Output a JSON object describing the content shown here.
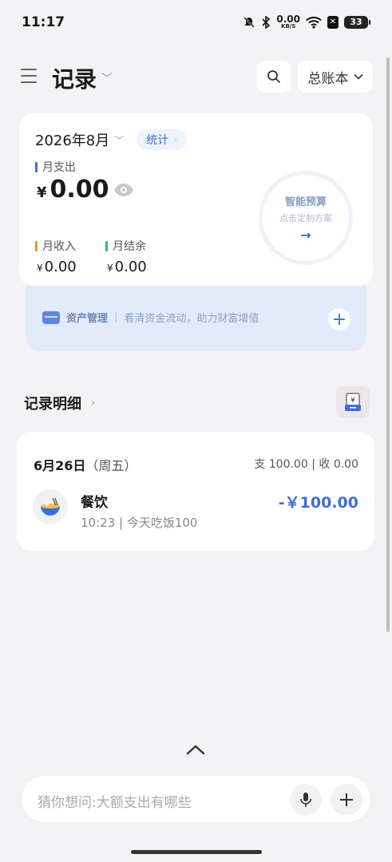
{
  "status_bar": {
    "time": "11:17",
    "net_speed_value": "0.00",
    "net_speed_unit": "KB/S",
    "battery": "33"
  },
  "header": {
    "title": "记录",
    "ledger": "总账本"
  },
  "summary": {
    "month": "2026年8月",
    "stats_label": "统计",
    "expense_label": "月支出",
    "currency": "¥",
    "expense_value": "0.00",
    "income_label": "月收入",
    "income_value": "0.00",
    "balance_label": "月结余",
    "balance_value": "0.00",
    "budget_title": "智能预算",
    "budget_sub": "点击定制方案",
    "budget_arrow": "→"
  },
  "asset": {
    "label": "资产管理",
    "separator": "|",
    "desc": "看清资金流动，助力财富增值"
  },
  "records": {
    "title": "记录明细",
    "day": {
      "date": "6月26日",
      "weekday": "（周五）",
      "summary": "支 100.00 | 收 0.00",
      "items": [
        {
          "category": "餐饮",
          "note": "10:23 | 今天吃饭100",
          "amount": "-￥100.00"
        }
      ]
    }
  },
  "input": {
    "placeholder": "猜你想问:大额支出有哪些"
  },
  "colors": {
    "accent": "#3d6fd8",
    "expense_bar": "#3d6fd8",
    "income_bar": "#e39a3a",
    "balance_bar": "#2fb58a"
  }
}
